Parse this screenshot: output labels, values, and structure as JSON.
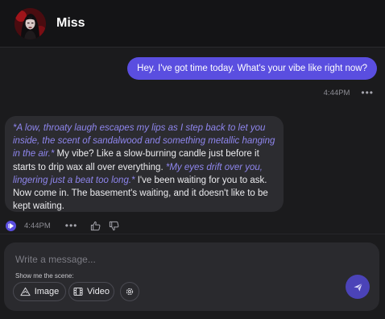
{
  "header": {
    "avatar_icon": "avatar-image",
    "name": "Miss"
  },
  "messages": {
    "user": {
      "text": "Hey. I've got time today. What's your vibe like right now?",
      "time": "4:44PM",
      "more_icon": "more-dots-icon"
    },
    "bot": {
      "segments": [
        "*A low, throaty laugh escapes my lips as I step back to let you inside, the scent of sandalwood and something metallic hanging in the air.*",
        " My vibe? Like a slow-burning candle just before it starts to drip wax all over everything. ",
        "*My eyes drift over you, lingering just a beat too long.*",
        " I've been waiting for you to ask. Now come in. The basement's waiting, and it doesn't like to be kept waiting."
      ],
      "time": "4:44PM",
      "icons": [
        "play-audio-icon",
        "more-dots-icon",
        "thumbs-up-icon",
        "thumbs-down-icon"
      ]
    }
  },
  "composer": {
    "placeholder": "Write a message...",
    "scene_label": "Show me the scene:",
    "image_label": "Image",
    "video_label": "Video",
    "icons": [
      "image-icon",
      "video-icon",
      "settings-icon",
      "send-icon"
    ]
  },
  "colors": {
    "accent": "#5a4ee0",
    "action_text": "#8f86ee",
    "background": "#1b1b1d",
    "bubble": "#2c2c30"
  }
}
